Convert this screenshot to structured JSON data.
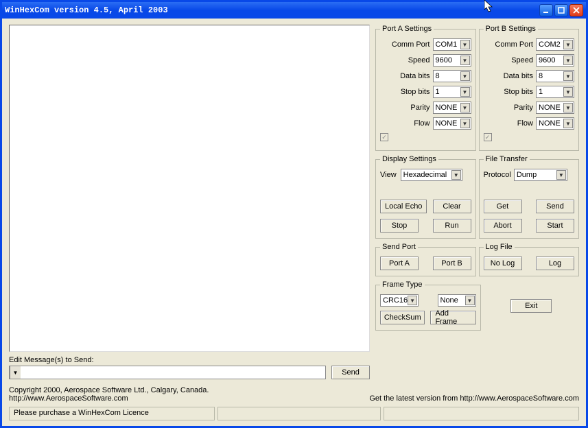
{
  "window": {
    "title": "WinHexCom version 4.5, April 2003"
  },
  "portA": {
    "legend": "Port A Settings",
    "comm_label": "Comm Port",
    "comm": "COM1",
    "speed_label": "Speed",
    "speed": "9600",
    "databits_label": "Data bits",
    "databits": "8",
    "stopbits_label": "Stop bits",
    "stopbits": "1",
    "parity_label": "Parity",
    "parity": "NONE",
    "flow_label": "Flow",
    "flow": "NONE",
    "checked": "✓"
  },
  "portB": {
    "legend": "Port B Settings",
    "comm_label": "Comm Port",
    "comm": "COM2",
    "speed_label": "Speed",
    "speed": "9600",
    "databits_label": "Data bits",
    "databits": "8",
    "stopbits_label": "Stop bits",
    "stopbits": "1",
    "parity_label": "Parity",
    "parity": "NONE",
    "flow_label": "Flow",
    "flow": "NONE",
    "checked": "✓"
  },
  "display": {
    "legend": "Display Settings",
    "view_label": "View",
    "view": "Hexadecimal",
    "local_echo": "Local Echo",
    "clear": "Clear",
    "stop": "Stop",
    "run": "Run"
  },
  "filetransfer": {
    "legend": "File Transfer",
    "protocol_label": "Protocol",
    "protocol": "Dump",
    "get": "Get",
    "send": "Send",
    "abort": "Abort",
    "start": "Start"
  },
  "sendport": {
    "legend": "Send Port",
    "a": "Port A",
    "b": "Port B"
  },
  "logfile": {
    "legend": "Log File",
    "nolog": "No Log",
    "log": "Log"
  },
  "frametype": {
    "legend": "Frame Type",
    "crc_sel": "CRC16",
    "none_sel": "None",
    "checksum": "CheckSum",
    "addframe": "Add Frame"
  },
  "edit": {
    "label": "Edit Message(s) to Send:",
    "send": "Send",
    "value": ""
  },
  "exit": "Exit",
  "footer": {
    "left1": "Copyright 2000, Aerospace Software Ltd., Calgary, Canada.",
    "left2": "http://www.AerospaceSoftware.com",
    "right": "Get the latest version from http://www.AerospaceSoftware.com"
  },
  "status": {
    "c1": "Please purchase a WinHexCom Licence",
    "c2": "",
    "c3": ""
  }
}
